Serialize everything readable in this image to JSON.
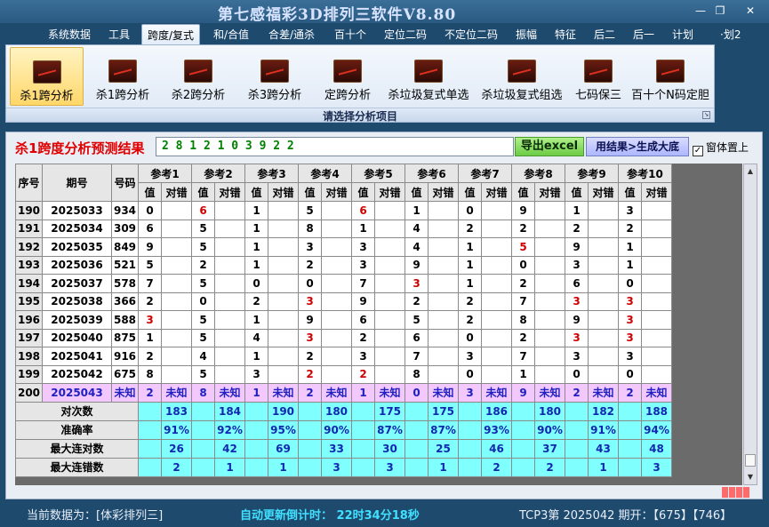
{
  "window": {
    "title": "第七感福彩3D排列三软件V8.80",
    "min_glyph": "—",
    "max_glyph": "❐",
    "close_glyph": "✕"
  },
  "menu": [
    "系统数据",
    "工具",
    "跨度/复式",
    "和/合值",
    "合差/通杀",
    "百十个",
    "定位二码",
    "不定位二码",
    "振幅",
    "特征",
    "后二",
    "后一",
    "计划",
    "·划2"
  ],
  "active_menu_index": 2,
  "ribbon": {
    "buttons": [
      "杀1跨分析",
      "杀1跨分析",
      "杀2跨分析",
      "杀3跨分析",
      "定跨分析",
      "杀垃圾复式单选",
      "杀垃圾复式组选",
      "七码保三",
      "百十个N码定胆"
    ],
    "selected_index": 0,
    "caption": "请选择分析项目",
    "launcher_glyph": "↘"
  },
  "result": {
    "title": "杀1跨度分析预测结果",
    "value": "2 8 1 2 1 0 3 9 2 2",
    "export_label": "导出excel",
    "generate_label": "用结果>生成大底",
    "pin_label": "窗体置上",
    "pin_checked": true,
    "pin_mark": "✓"
  },
  "table": {
    "col_headers": [
      "序号",
      "期号",
      "号码"
    ],
    "refs": [
      "参考1",
      "参考2",
      "参考3",
      "参考4",
      "参考5",
      "参考6",
      "参考7",
      "参考8",
      "参考9",
      "参考10"
    ],
    "sub_value": "值",
    "sub_check": "对错",
    "hit_text": "对",
    "rows": [
      {
        "seq": "190",
        "period": "2025033",
        "num": "934",
        "refs": [
          [
            "0",
            true
          ],
          [
            "6",
            false
          ],
          [
            "1",
            true
          ],
          [
            "5",
            true
          ],
          [
            "6",
            false
          ],
          [
            "1",
            true
          ],
          [
            "0",
            true
          ],
          [
            "9",
            true
          ],
          [
            "1",
            true
          ],
          [
            "3",
            true
          ]
        ]
      },
      {
        "seq": "191",
        "period": "2025034",
        "num": "309",
        "refs": [
          [
            "6",
            true
          ],
          [
            "5",
            true
          ],
          [
            "1",
            true
          ],
          [
            "8",
            true
          ],
          [
            "1",
            true
          ],
          [
            "4",
            true
          ],
          [
            "2",
            true
          ],
          [
            "2",
            true
          ],
          [
            "2",
            true
          ],
          [
            "2",
            true
          ]
        ]
      },
      {
        "seq": "192",
        "period": "2025035",
        "num": "849",
        "refs": [
          [
            "9",
            true
          ],
          [
            "5",
            true
          ],
          [
            "1",
            true
          ],
          [
            "3",
            true
          ],
          [
            "3",
            true
          ],
          [
            "4",
            true
          ],
          [
            "1",
            true
          ],
          [
            "5",
            false
          ],
          [
            "9",
            true
          ],
          [
            "1",
            true
          ]
        ]
      },
      {
        "seq": "193",
        "period": "2025036",
        "num": "521",
        "refs": [
          [
            "5",
            true
          ],
          [
            "2",
            true
          ],
          [
            "1",
            true
          ],
          [
            "2",
            true
          ],
          [
            "3",
            true
          ],
          [
            "9",
            true
          ],
          [
            "1",
            true
          ],
          [
            "0",
            true
          ],
          [
            "3",
            true
          ],
          [
            "1",
            true
          ]
        ]
      },
      {
        "seq": "194",
        "period": "2025037",
        "num": "578",
        "refs": [
          [
            "7",
            true
          ],
          [
            "5",
            true
          ],
          [
            "0",
            true
          ],
          [
            "0",
            true
          ],
          [
            "7",
            true
          ],
          [
            "3",
            false
          ],
          [
            "1",
            true
          ],
          [
            "2",
            true
          ],
          [
            "6",
            true
          ],
          [
            "0",
            true
          ]
        ]
      },
      {
        "seq": "195",
        "period": "2025038",
        "num": "366",
        "refs": [
          [
            "2",
            true
          ],
          [
            "0",
            true
          ],
          [
            "2",
            true
          ],
          [
            "3",
            false
          ],
          [
            "9",
            true
          ],
          [
            "2",
            true
          ],
          [
            "2",
            true
          ],
          [
            "7",
            true
          ],
          [
            "3",
            false
          ],
          [
            "3",
            false
          ]
        ]
      },
      {
        "seq": "196",
        "period": "2025039",
        "num": "588",
        "refs": [
          [
            "3",
            false
          ],
          [
            "5",
            true
          ],
          [
            "1",
            true
          ],
          [
            "9",
            true
          ],
          [
            "6",
            true
          ],
          [
            "5",
            true
          ],
          [
            "2",
            true
          ],
          [
            "8",
            true
          ],
          [
            "9",
            true
          ],
          [
            "3",
            false
          ]
        ]
      },
      {
        "seq": "197",
        "period": "2025040",
        "num": "875",
        "refs": [
          [
            "1",
            true
          ],
          [
            "5",
            true
          ],
          [
            "4",
            true
          ],
          [
            "3",
            false
          ],
          [
            "2",
            true
          ],
          [
            "6",
            true
          ],
          [
            "0",
            true
          ],
          [
            "2",
            true
          ],
          [
            "3",
            false
          ],
          [
            "3",
            false
          ]
        ]
      },
      {
        "seq": "198",
        "period": "2025041",
        "num": "916",
        "refs": [
          [
            "2",
            true
          ],
          [
            "4",
            true
          ],
          [
            "1",
            true
          ],
          [
            "2",
            true
          ],
          [
            "3",
            true
          ],
          [
            "7",
            true
          ],
          [
            "3",
            true
          ],
          [
            "7",
            true
          ],
          [
            "3",
            true
          ],
          [
            "3",
            true
          ]
        ]
      },
      {
        "seq": "199",
        "period": "2025042",
        "num": "675",
        "refs": [
          [
            "8",
            true
          ],
          [
            "5",
            true
          ],
          [
            "3",
            true
          ],
          [
            "2",
            false
          ],
          [
            "2",
            false
          ],
          [
            "8",
            true
          ],
          [
            "0",
            true
          ],
          [
            "1",
            true
          ],
          [
            "0",
            true
          ],
          [
            "0",
            true
          ]
        ]
      }
    ],
    "unknown_row": {
      "seq": "200",
      "period": "2025043",
      "num": "未知",
      "values": [
        "2",
        "8",
        "1",
        "2",
        "1",
        "0",
        "3",
        "9",
        "2",
        "2"
      ],
      "status": "未知"
    },
    "stats": [
      {
        "label": "对次数",
        "values": [
          "183",
          "184",
          "190",
          "180",
          "175",
          "175",
          "186",
          "180",
          "182",
          "188"
        ]
      },
      {
        "label": "准确率",
        "values": [
          "91%",
          "92%",
          "95%",
          "90%",
          "87%",
          "87%",
          "93%",
          "90%",
          "91%",
          "94%"
        ]
      },
      {
        "label": "最大连对数",
        "values": [
          "26",
          "42",
          "69",
          "33",
          "30",
          "25",
          "46",
          "37",
          "43",
          "48"
        ]
      },
      {
        "label": "最大连错数",
        "values": [
          "2",
          "1",
          "1",
          "3",
          "3",
          "1",
          "2",
          "2",
          "1",
          "3"
        ]
      }
    ]
  },
  "status": {
    "current": "当前数据为：[体彩排列三]",
    "countdown": "自动更新倒计时：  22时34分18秒",
    "draw": "TCP3第 2025042 期开：【675】【746】"
  },
  "colors": {
    "hit": "#ff0000",
    "unknown_row": "#f2c8ff",
    "stats_row": "#80ffff",
    "accent_text": "#1028b0"
  }
}
